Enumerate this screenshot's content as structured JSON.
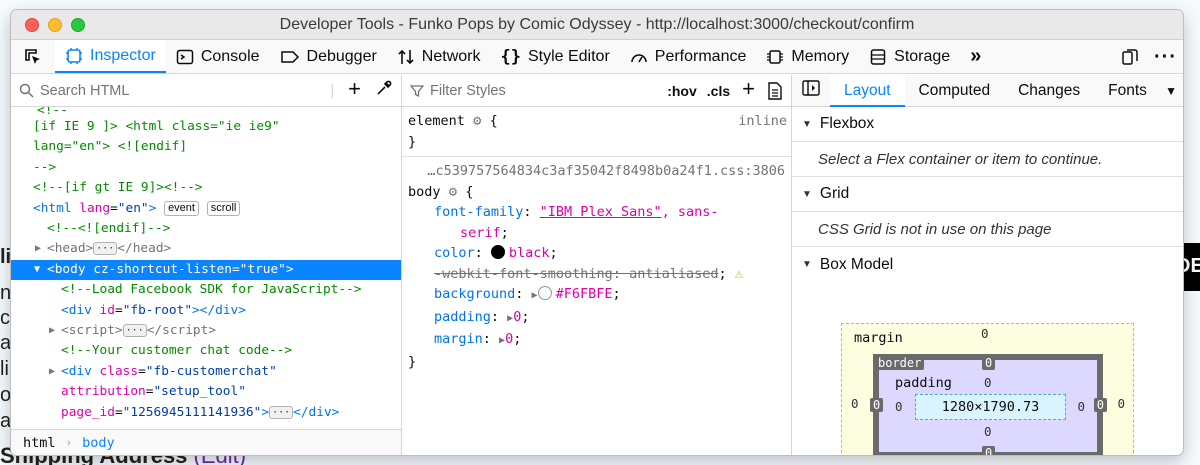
{
  "window": {
    "title": "Developer Tools - Funko Pops by Comic Odyssey - http://localhost:3000/checkout/confirm"
  },
  "background_page": {
    "right_label": "DE",
    "shipping_heading": "Shipping Address",
    "shipping_edit": "(Edit)"
  },
  "toolbar": {
    "tabs": [
      {
        "label": "Inspector",
        "icon": "inspector-icon"
      },
      {
        "label": "Console",
        "icon": "console-icon"
      },
      {
        "label": "Debugger",
        "icon": "debugger-icon"
      },
      {
        "label": "Network",
        "icon": "network-icon"
      },
      {
        "label": "Style Editor",
        "icon": "style-editor-icon"
      },
      {
        "label": "Performance",
        "icon": "performance-icon"
      },
      {
        "label": "Memory",
        "icon": "memory-icon"
      },
      {
        "label": "Storage",
        "icon": "storage-icon"
      }
    ],
    "active": "Inspector"
  },
  "markup": {
    "search_placeholder": "Search HTML",
    "badges": {
      "event": "event",
      "scroll": "scroll"
    },
    "breadcrumbs": [
      "html",
      "body"
    ]
  },
  "rules": {
    "filter_placeholder": "Filter Styles",
    "hov": ":hov",
    "cls": ".cls",
    "element_selector": "element",
    "inline": "inline",
    "source": "…c539757564834c3af35042f8498b0a24f1.css:3806",
    "body_selector": "body",
    "declarations": [
      {
        "prop": "font-family",
        "value": "\"IBM Plex Sans\", sans-serif"
      },
      {
        "prop": "color",
        "value": "black"
      },
      {
        "prop": "-webkit-font-smoothing",
        "value": "antialiased"
      },
      {
        "prop": "background",
        "value": "#F6FBFE"
      },
      {
        "prop": "padding",
        "value": "0"
      },
      {
        "prop": "margin",
        "value": "0"
      }
    ],
    "swatch_black": "#000000",
    "swatch_bg": "#F6FBFE"
  },
  "layout": {
    "tabs": [
      "Layout",
      "Computed",
      "Changes",
      "Fonts"
    ],
    "active_tab": "Layout",
    "flexbox_title": "Flexbox",
    "flexbox_msg": "Select a Flex container or item to continue.",
    "grid_title": "Grid",
    "grid_msg": "CSS Grid is not in use on this page",
    "boxmodel_title": "Box Model",
    "box": {
      "margin_label": "margin",
      "border_label": "border",
      "padding_label": "padding",
      "content_size": "1280×1790.73",
      "margin": {
        "top": "0",
        "right": "0",
        "bottom": "0",
        "left": "0"
      },
      "border": {
        "top": "0",
        "right": "0",
        "bottom": "0",
        "left": "0"
      },
      "padding": {
        "top": "0",
        "right": "0",
        "bottom": "0",
        "left": "0"
      }
    }
  }
}
